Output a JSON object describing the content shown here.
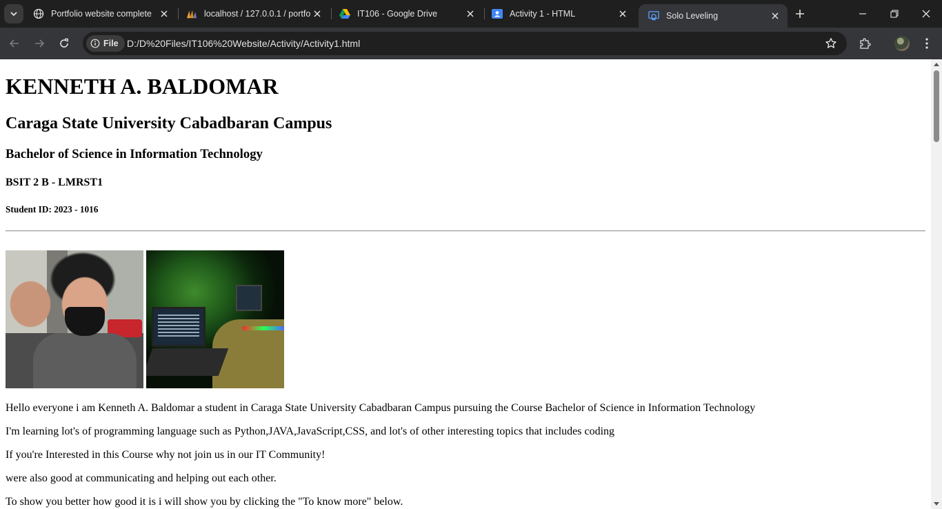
{
  "browser": {
    "tabs": [
      {
        "title": "Portfolio website complete",
        "icon": "globe-icon"
      },
      {
        "title": "localhost / 127.0.0.1 / portfo",
        "icon": "phpmyadmin-icon"
      },
      {
        "title": "IT106 - Google Drive",
        "icon": "google-drive-icon"
      },
      {
        "title": "Activity 1 - HTML",
        "icon": "google-classroom-icon"
      },
      {
        "title": "Solo Leveling",
        "icon": "edge-doc-icon",
        "active": true
      }
    ],
    "address": {
      "scheme_chip": "File",
      "url": "D:/D%20Files/IT106%20Website/Activity/Activity1.html"
    },
    "colors": {
      "chrome_bg": "#1f1f1f",
      "toolbar_bg": "#35363a"
    }
  },
  "page": {
    "name": "KENNETH A. BALDOMAR",
    "school": "Caraga State University Cabadbaran Campus",
    "course": "Bachelor of Science in Information Technology",
    "section": "BSIT 2 B - LMRST1",
    "student_id": "Student ID: 2023 - 1016",
    "paragraphs": [
      "Hello everyone i am Kenneth A. Baldomar a student in Caraga State University Cabadbaran Campus pursuing the Course Bachelor of Science in Information Technology",
      "I'm learning lot's of programming language such as Python,JAVA,JavaScript,CSS, and lot's of other interesting topics that includes coding",
      "If you're Interested in this Course why not join us in our IT Community!",
      "were also good at communicating and helping out each other.",
      "To show you better how good it is i will show you by clicking the \"To know more\" below."
    ]
  }
}
